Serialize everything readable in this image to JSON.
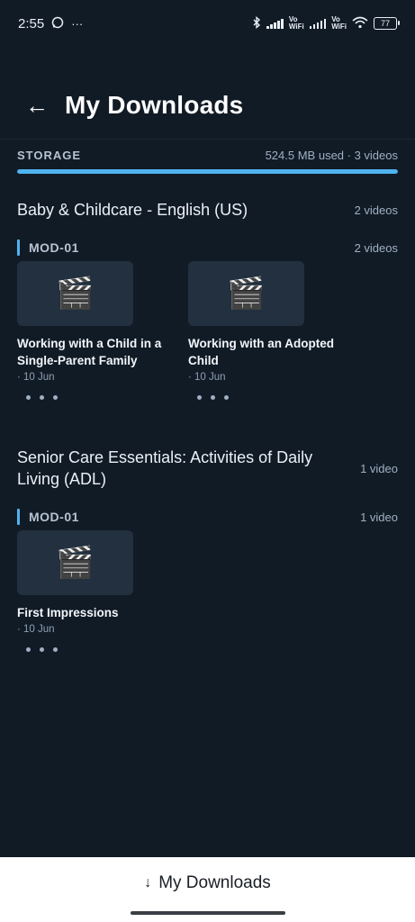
{
  "status_bar": {
    "time": "2:55",
    "notifications": [
      "whatsapp-icon",
      "more-dots-icon"
    ],
    "vowifi_top": "Vo",
    "vowifi_bottom": "WiFi",
    "battery": "77"
  },
  "header": {
    "back_icon": "←",
    "title": "My Downloads"
  },
  "storage": {
    "label": "STORAGE",
    "info": "524.5 MB used · 3 videos",
    "fill_fraction": 1.0,
    "fill_color": "#4fb3ef"
  },
  "courses": [
    {
      "title": "Baby & Childcare - English (US)",
      "count": "2 videos",
      "modules": [
        {
          "label": "MOD-01",
          "count": "2 videos",
          "videos": [
            {
              "title": "Working with a Child in a Single-Parent Family",
              "date": "· 10 Jun",
              "thumb_icon": "🎬"
            },
            {
              "title": "Working with an Adopted Child",
              "date": "· 10 Jun",
              "thumb_icon": "🎬"
            }
          ]
        }
      ]
    },
    {
      "title": "Senior Care Essentials: Activities of Daily Living (ADL)",
      "count": "1 video",
      "modules": [
        {
          "label": "MOD-01",
          "count": "1 video",
          "videos": [
            {
              "title": "First Impressions",
              "date": "· 10 Jun",
              "thumb_icon": "🎬"
            }
          ]
        }
      ]
    }
  ],
  "bottom_nav": {
    "icon": "↓",
    "label": "My Downloads"
  },
  "colors": {
    "background": "#111b26",
    "accent": "#4fb3ef"
  }
}
